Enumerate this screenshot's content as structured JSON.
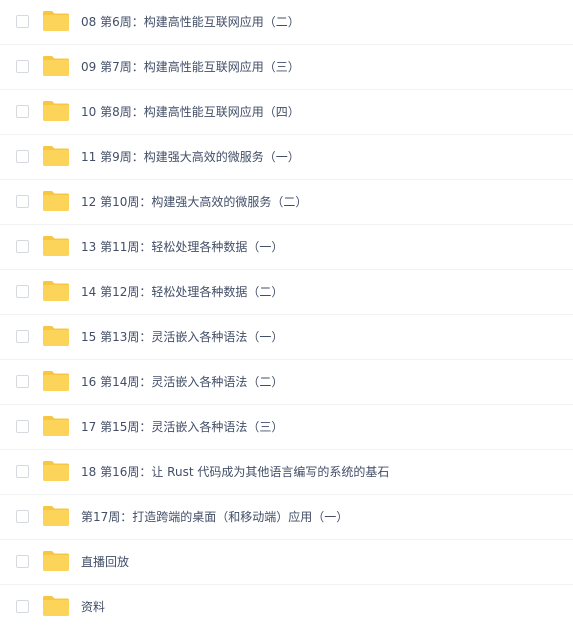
{
  "colors": {
    "folder_body": "#fdd45a",
    "folder_tab": "#f7c741",
    "text": "#424e67",
    "divider": "#f1f2f4",
    "checkbox_border": "#d6d9de"
  },
  "files": [
    {
      "name": "08 第6周：构建高性能互联网应用（二）",
      "icon": "folder-icon"
    },
    {
      "name": "09 第7周：构建高性能互联网应用（三）",
      "icon": "folder-icon"
    },
    {
      "name": "10 第8周：构建高性能互联网应用（四）",
      "icon": "folder-icon"
    },
    {
      "name": "11 第9周：构建强大高效的微服务（一）",
      "icon": "folder-icon"
    },
    {
      "name": "12 第10周：构建强大高效的微服务（二）",
      "icon": "folder-icon"
    },
    {
      "name": "13 第11周：轻松处理各种数据（一）",
      "icon": "folder-icon"
    },
    {
      "name": "14 第12周：轻松处理各种数据（二）",
      "icon": "folder-icon"
    },
    {
      "name": "15 第13周：灵活嵌入各种语法（一）",
      "icon": "folder-icon"
    },
    {
      "name": "16 第14周：灵活嵌入各种语法（二）",
      "icon": "folder-icon"
    },
    {
      "name": "17 第15周：灵活嵌入各种语法（三）",
      "icon": "folder-icon"
    },
    {
      "name": "18 第16周：让 Rust 代码成为其他语言编写的系统的基石",
      "icon": "folder-icon"
    },
    {
      "name": "第17周：打造跨端的桌面（和移动端）应用（一）",
      "icon": "folder-icon"
    },
    {
      "name": "直播回放",
      "icon": "folder-icon"
    },
    {
      "name": "资料",
      "icon": "folder-icon"
    }
  ]
}
